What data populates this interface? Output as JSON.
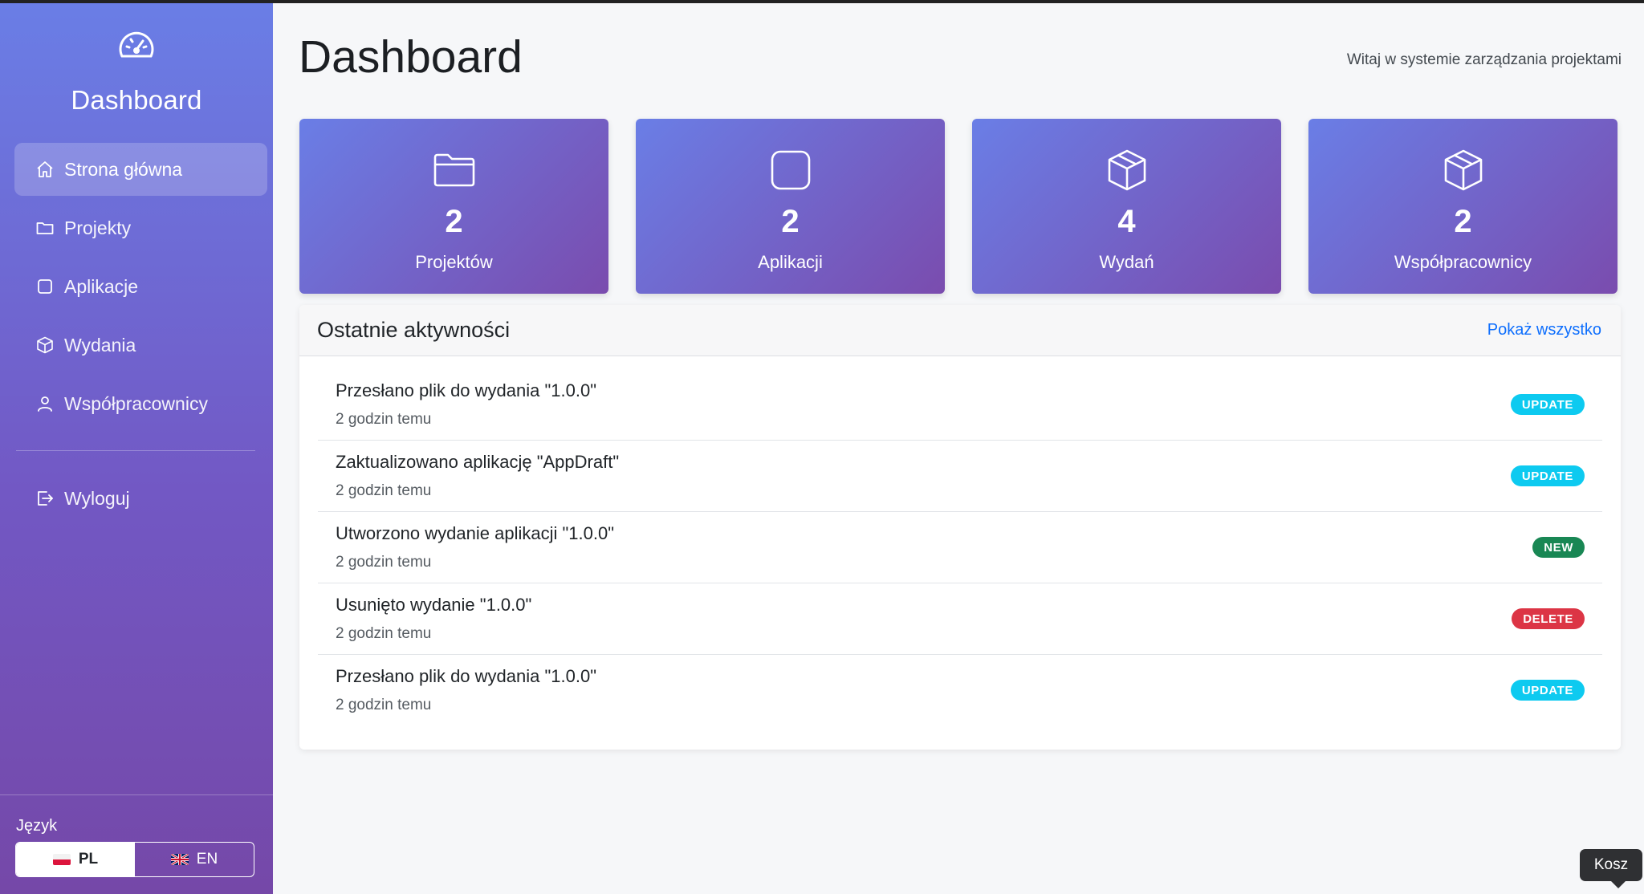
{
  "sidebar": {
    "brand_icon": "speedometer-icon",
    "brand_title": "Dashboard",
    "items": [
      {
        "label": "Strona główna",
        "icon": "home-icon",
        "active": true
      },
      {
        "label": "Projekty",
        "icon": "folder-icon",
        "active": false
      },
      {
        "label": "Aplikacje",
        "icon": "square-icon",
        "active": false
      },
      {
        "label": "Wydania",
        "icon": "box-icon",
        "active": false
      },
      {
        "label": "Współpracownicy",
        "icon": "person-icon",
        "active": false
      }
    ],
    "logout": {
      "label": "Wyloguj",
      "icon": "logout-icon"
    },
    "language": {
      "label": "Język",
      "options": [
        {
          "code": "PL",
          "flag": "poland-flag-icon",
          "active": true
        },
        {
          "code": "EN",
          "flag": "uk-flag-icon",
          "active": false
        }
      ]
    }
  },
  "header": {
    "title": "Dashboard",
    "welcome": "Witaj w systemie zarządzania projektami"
  },
  "stats": [
    {
      "value": "2",
      "label": "Projektów",
      "icon": "folder-icon"
    },
    {
      "value": "2",
      "label": "Aplikacji",
      "icon": "square-icon"
    },
    {
      "value": "4",
      "label": "Wydań",
      "icon": "box-icon"
    },
    {
      "value": "2",
      "label": "Współpracownicy",
      "icon": "box-icon"
    }
  ],
  "activities": {
    "title": "Ostatnie aktywności",
    "show_all": "Pokaż wszystko",
    "items": [
      {
        "title": "Przesłano plik do wydania \"1.0.0\"",
        "time": "2 godzin temu",
        "badge": "UPDATE",
        "badge_color": "#0dcaf0"
      },
      {
        "title": "Zaktualizowano aplikację \"AppDraft\"",
        "time": "2 godzin temu",
        "badge": "UPDATE",
        "badge_color": "#0dcaf0"
      },
      {
        "title": "Utworzono wydanie aplikacji \"1.0.0\"",
        "time": "2 godzin temu",
        "badge": "NEW",
        "badge_color": "#198754"
      },
      {
        "title": "Usunięto wydanie \"1.0.0\"",
        "time": "2 godzin temu",
        "badge": "DELETE",
        "badge_color": "#dc3545"
      },
      {
        "title": "Przesłano plik do wydania \"1.0.0\"",
        "time": "2 godzin temu",
        "badge": "UPDATE",
        "badge_color": "#0dcaf0"
      }
    ]
  },
  "tooltip": {
    "text": "Kosz"
  },
  "colors": {
    "accent_start": "#6a7ee6",
    "accent_end": "#7548a8",
    "link": "#0d6efd"
  }
}
